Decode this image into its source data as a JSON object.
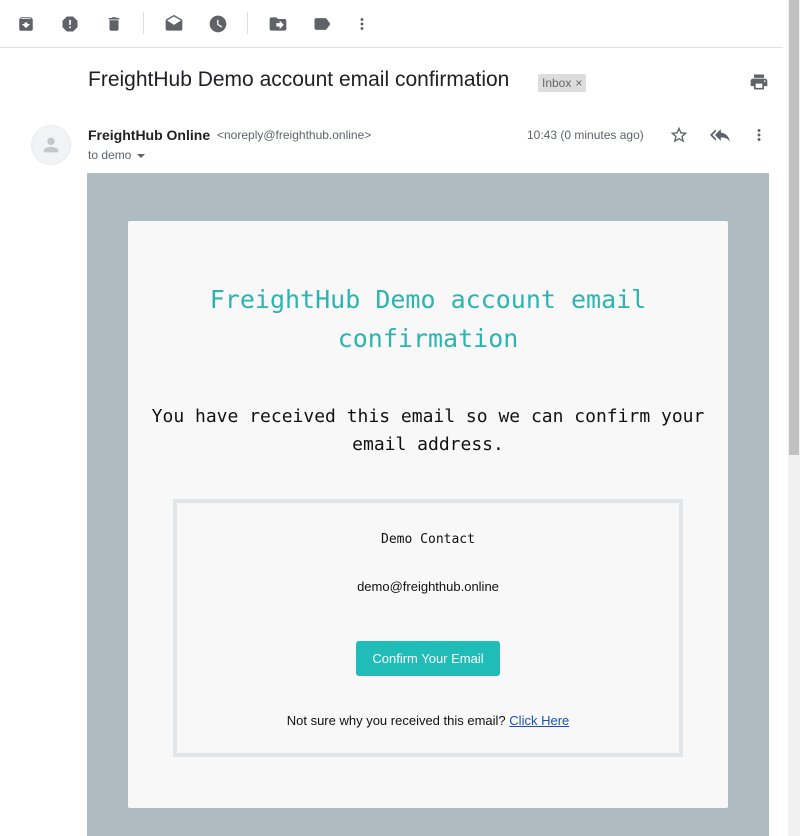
{
  "toolbar": {
    "icons": [
      "archive-icon",
      "report-spam-icon",
      "delete-icon",
      "mark-unread-icon",
      "snooze-icon",
      "move-to-icon",
      "label-icon",
      "more-vert-icon"
    ]
  },
  "message": {
    "subject": "FreightHub Demo account email confirmation",
    "label": "Inbox",
    "label_remove": "×",
    "sender_name": "FreightHub Online",
    "sender_email": "<noreply@freighthub.online>",
    "to": "to demo",
    "timestamp": "10:43 (0 minutes ago)"
  },
  "email": {
    "title": "FreightHub Demo account email confirmation",
    "intro": "You have received this email so we can confirm your email address.",
    "contact_name": "Demo Contact",
    "contact_email": "demo@freighthub.online",
    "button_label": "Confirm Your Email",
    "not_sure_text": "Not sure why you received this email?",
    "click_here": "Click Here"
  },
  "colors": {
    "accent": "#2bb5b2",
    "button": "#20bdb8",
    "email_background": "#aebcc2",
    "link": "#1a4fc4"
  }
}
